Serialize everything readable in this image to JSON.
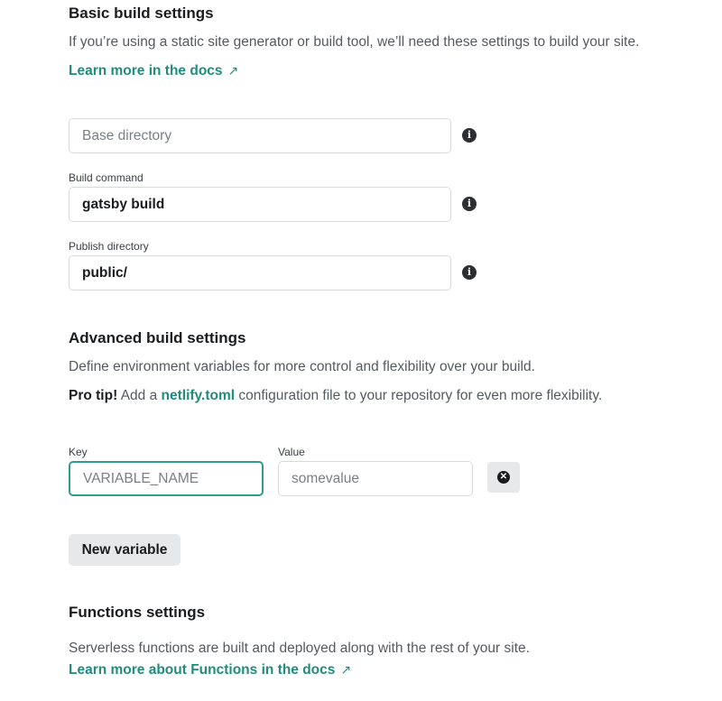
{
  "basic": {
    "heading": "Basic build settings",
    "description": "If you’re using a static site generator or build tool, we’ll need these settings to build your site.",
    "docs_link": "Learn more in the docs",
    "link_arrow": "↗",
    "base_dir": {
      "placeholder": "Base directory",
      "value": ""
    },
    "build_command": {
      "label": "Build command",
      "value": "gatsby build"
    },
    "publish_dir": {
      "label": "Publish directory",
      "value": "public/"
    },
    "info_glyph": "i"
  },
  "advanced": {
    "heading": "Advanced build settings",
    "description": "Define environment variables for more control and flexibility over your build.",
    "protip_bold": "Pro tip!",
    "protip_pre": " Add a ",
    "protip_link": "netlify.toml",
    "protip_post": " configuration file to your repository for even more flexibility.",
    "key_label": "Key",
    "key_placeholder": "VARIABLE_NAME",
    "value_label": "Value",
    "value_placeholder": "somevalue",
    "delete_glyph": "✕",
    "new_variable": "New variable"
  },
  "functions": {
    "heading": "Functions settings",
    "description": "Serverless functions are built and deployed along with the rest of your site.",
    "docs_link": "Learn more about Functions in the docs",
    "link_arrow": "↗"
  }
}
